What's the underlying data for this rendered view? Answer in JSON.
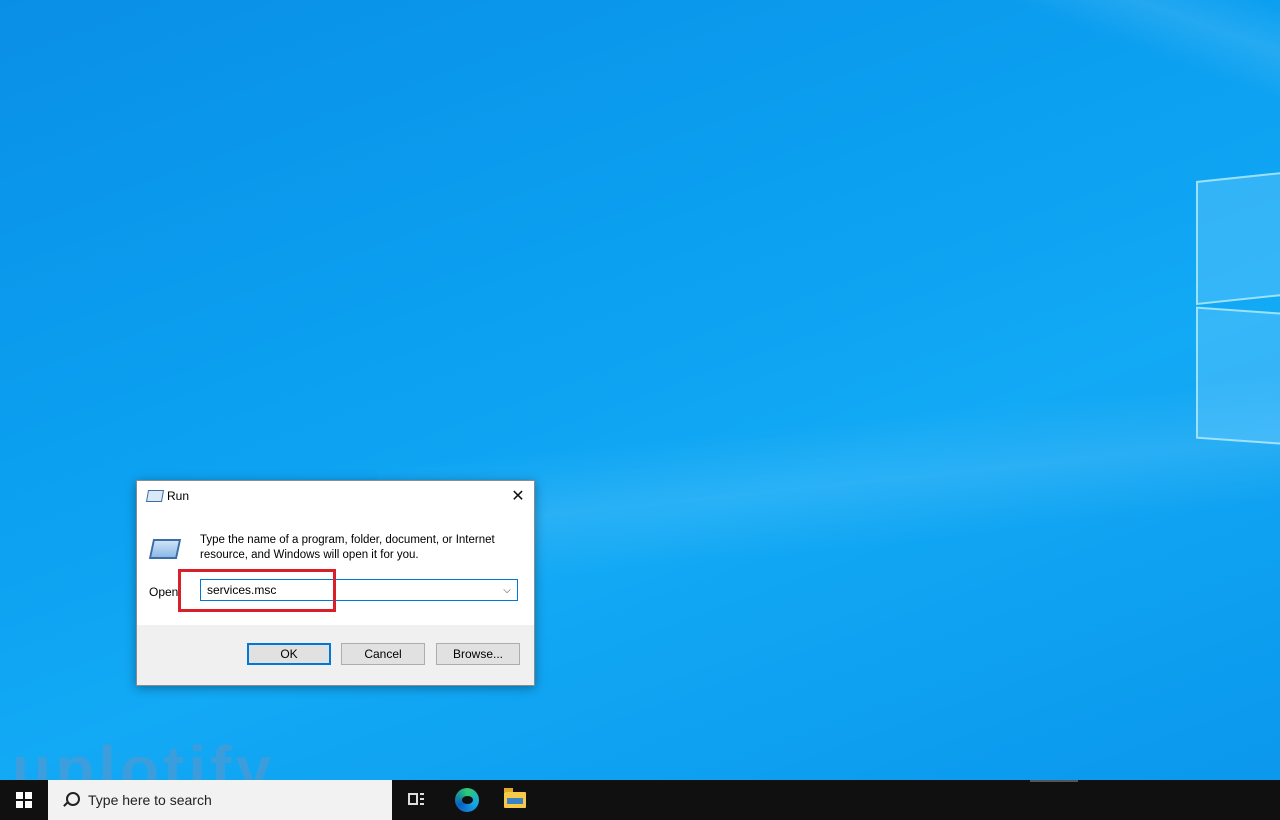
{
  "dialog": {
    "title": "Run",
    "instructions": "Type the name of a program, folder, document, or Internet resource, and Windows will open it for you.",
    "open_label": "Open:",
    "input_value": "services.msc",
    "ok_label": "OK",
    "cancel_label": "Cancel",
    "browse_label": "Browse...",
    "close_glyph": "✕",
    "dropdown_glyph": "⌵"
  },
  "taskbar": {
    "search_placeholder": "Type here to search"
  },
  "watermark": {
    "text": "uplotify"
  },
  "colors": {
    "highlight": "#d9202a",
    "accent": "#0078d7",
    "desktop": "#0b9ff0",
    "taskbar": "#101010"
  },
  "icons": [
    "run-icon",
    "close-icon",
    "chevron-down-icon",
    "windows-start-icon",
    "search-icon",
    "task-view-icon",
    "edge-icon",
    "file-explorer-icon"
  ]
}
